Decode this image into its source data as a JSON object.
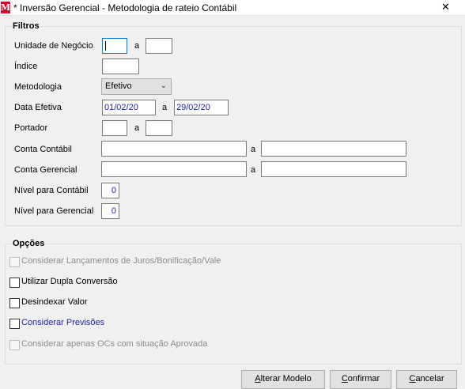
{
  "window": {
    "title": "* Inversão Gerencial - Metodologia de rateio Contábil",
    "close_glyph": "✕",
    "app_icon_glyph": "M"
  },
  "filtros": {
    "title": "Filtros",
    "range_separator": "a",
    "unidade_negocio": {
      "label": "Unidade de Negócio",
      "from": "",
      "to": ""
    },
    "indice": {
      "label": "Índice",
      "value": ""
    },
    "metodologia": {
      "label": "Metodologia",
      "selected": "Efetivo"
    },
    "data_efetiva": {
      "label": "Data Efetiva",
      "from": "01/02/20",
      "to": "29/02/20"
    },
    "portador": {
      "label": "Portador",
      "from": "",
      "to": ""
    },
    "conta_contabil": {
      "label": "Conta Contábil",
      "from": "",
      "to": ""
    },
    "conta_gerencial": {
      "label": "Conta Gerencial",
      "from": "",
      "to": ""
    },
    "nivel_contabil": {
      "label": "Nível para Contábil",
      "value": "0"
    },
    "nivel_gerencial": {
      "label": "Nível para Gerencial",
      "value": "0"
    }
  },
  "opcoes": {
    "title": "Opções",
    "items": [
      {
        "label": "Considerar Lançamentos de Juros/Bonificação/Vale",
        "checked": false,
        "enabled": false
      },
      {
        "label": "Utilizar Dupla Conversão",
        "checked": false,
        "enabled": true
      },
      {
        "label": "Desindexar Valor",
        "checked": false,
        "enabled": true
      },
      {
        "label": "Considerar Previsões",
        "checked": false,
        "enabled": true
      },
      {
        "label": "Considerar apenas OCs com situação Aprovada",
        "checked": false,
        "enabled": false
      }
    ]
  },
  "buttons": {
    "alterar_modelo": {
      "mnemonic": "A",
      "rest": "lterar Modelo"
    },
    "confirmar": {
      "mnemonic": "C",
      "rest": "onfirmar"
    },
    "cancelar": {
      "mnemonic": "C",
      "rest": "ancelar"
    }
  },
  "colors": {
    "value_text": "#1f1fa8",
    "focus_border": "#0078d7",
    "brand_icon": "#c8102e"
  }
}
